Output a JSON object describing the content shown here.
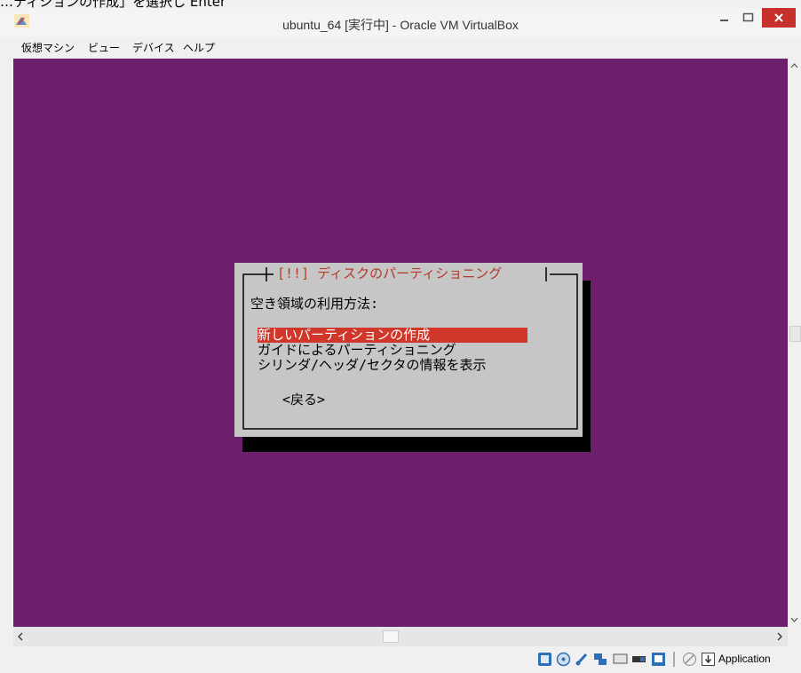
{
  "caption": "…ティションの作成」を選択し Enter",
  "window": {
    "title": "ubuntu_64 [実行中] - Oracle VM VirtualBox"
  },
  "menu": [
    "仮想マシン",
    "ビュー",
    "デバイス",
    "ヘルプ"
  ],
  "dialog": {
    "title": "[!!] ディスクのパーティショニング",
    "prompt": "空き領域の利用方法:",
    "options": [
      "新しいパーティションの作成",
      "ガイドによるパーティショニング",
      "シリンダ/ヘッダ/セクタの情報を表示"
    ],
    "selected_index": 0,
    "back_button": "<戻る>"
  },
  "statusbar": {
    "host_key_label": "Application"
  },
  "colors": {
    "guest_background": "#6e1f6b",
    "dialog_background": "#c6c6c6",
    "selection": "#d0362a",
    "title_text": "#b33a2a",
    "close_button": "#c7312c"
  }
}
